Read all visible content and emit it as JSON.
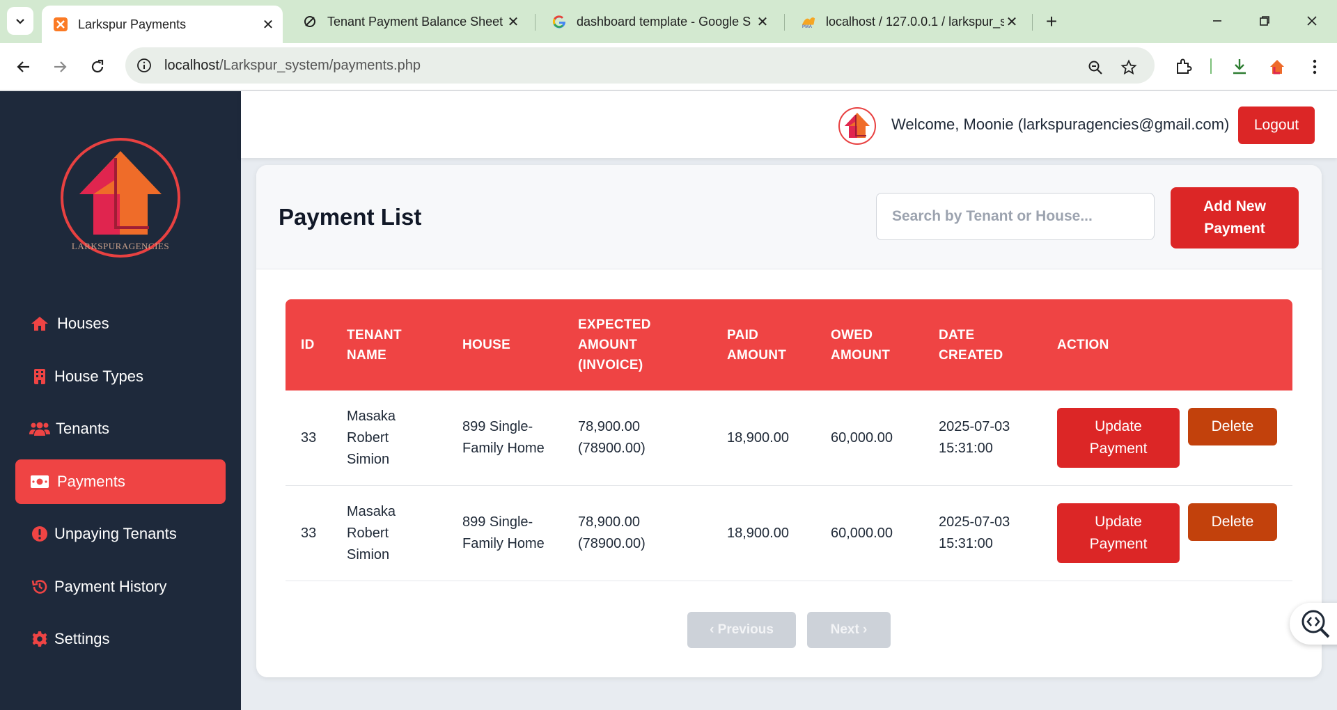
{
  "browser": {
    "tabs": [
      {
        "title": "Larkspur Payments",
        "active": true,
        "icon": "xampp-icon"
      },
      {
        "title": "Tenant Payment Balance Sheet",
        "active": false,
        "icon": "openai-icon"
      },
      {
        "title": "dashboard template - Google S",
        "active": false,
        "icon": "google-icon"
      },
      {
        "title": "localhost / 127.0.0.1 / larkspur_s",
        "active": false,
        "icon": "phpmyadmin-icon"
      }
    ],
    "url_host": "localhost",
    "url_path": "/Larkspur_system/payments.php"
  },
  "sidebar": {
    "logo_text": "LARKSPURAGENCIES",
    "items": [
      {
        "label": "Houses",
        "icon": "home-icon",
        "active": false
      },
      {
        "label": "House Types",
        "icon": "building-icon",
        "active": false
      },
      {
        "label": "Tenants",
        "icon": "users-icon",
        "active": false
      },
      {
        "label": "Payments",
        "icon": "money-bill-icon",
        "active": true
      },
      {
        "label": "Unpaying Tenants",
        "icon": "exclamation-circle-icon",
        "active": false
      },
      {
        "label": "Payment History",
        "icon": "history-icon",
        "active": false
      },
      {
        "label": "Settings",
        "icon": "gear-icon",
        "active": false
      }
    ]
  },
  "header": {
    "welcome": "Welcome, Moonie (larkspuragencies@gmail.com)",
    "logout_label": "Logout"
  },
  "main": {
    "title": "Payment List",
    "search_placeholder": "Search by Tenant or House...",
    "add_button": "Add New Payment",
    "columns": [
      "ID",
      "TENANT NAME",
      "HOUSE",
      "EXPECTED AMOUNT (INVOICE)",
      "PAID AMOUNT",
      "OWED AMOUNT",
      "DATE CREATED",
      "ACTION"
    ],
    "rows": [
      {
        "id": "33",
        "tenant": "Masaka Robert Simion",
        "house": "899 Single-Family Home",
        "expected": "78,900.00 (78900.00)",
        "paid": "18,900.00",
        "owed": "60,000.00",
        "date": "2025-07-03 15:31:00",
        "update_label": "Update Payment",
        "delete_label": "Delete"
      },
      {
        "id": "33",
        "tenant": "Masaka Robert Simion",
        "house": "899 Single-Family Home",
        "expected": "78,900.00 (78900.00)",
        "paid": "18,900.00",
        "owed": "60,000.00",
        "date": "2025-07-03 15:31:00",
        "update_label": "Update Payment",
        "delete_label": "Delete"
      }
    ],
    "pagination": {
      "previous": "‹ Previous",
      "next": "Next ›"
    }
  },
  "colors": {
    "accent": "#ef4444",
    "primary_button": "#dc2626",
    "delete_button": "#c2410c",
    "sidebar_bg": "#1e293b"
  }
}
